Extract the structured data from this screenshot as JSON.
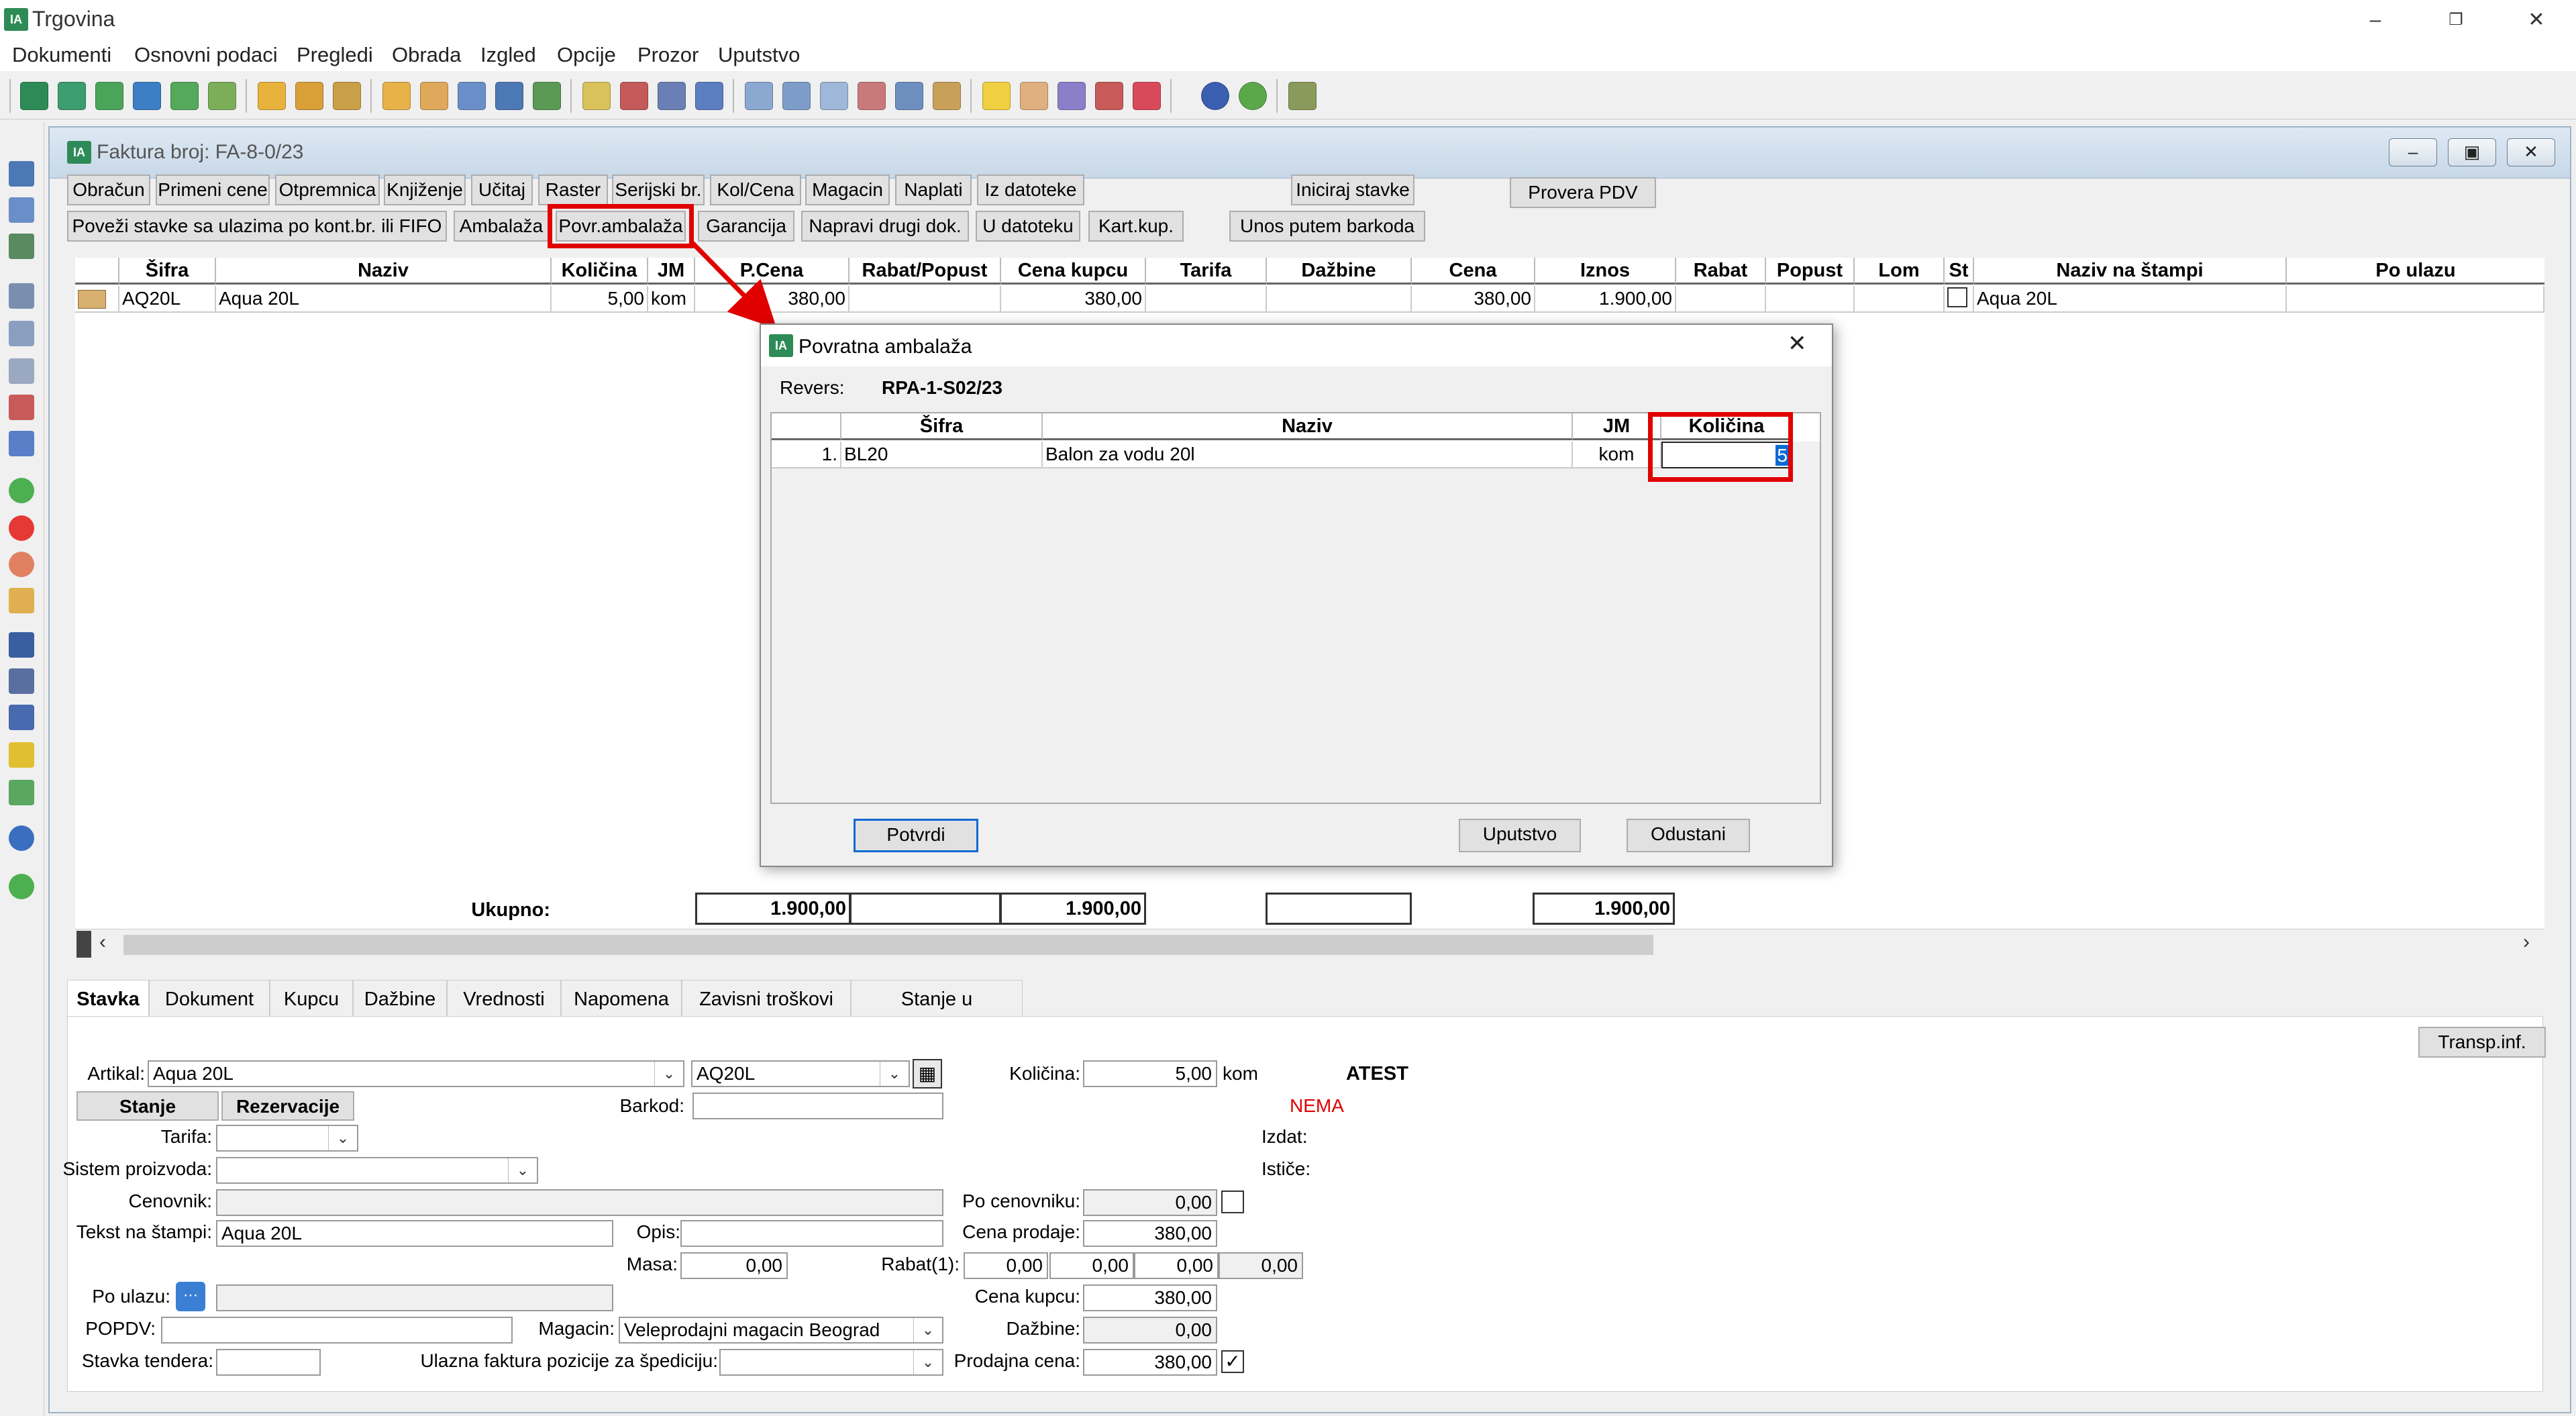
{
  "app": {
    "title": "Trgovina",
    "logo": "IA"
  },
  "menu": [
    "Dokumenti",
    "Osnovni podaci",
    "Pregledi",
    "Obrada",
    "Izgled",
    "Opcije",
    "Prozor",
    "Uputstvo"
  ],
  "window": {
    "title": "Faktura broj: FA-8-0/23"
  },
  "buttons_row1": [
    "Obračun",
    "Primeni cene",
    "Otpremnica",
    "Knjiženje",
    "Učitaj",
    "Raster",
    "Serijski br.",
    "Kol/Cena",
    "Magacin",
    "Naplati",
    "Iz datoteke",
    "Iniciraj stavke",
    "Provera PDV"
  ],
  "buttons_row2": [
    "Poveži stavke sa ulazima po kont.br. ili FIFO",
    "Ambalaža",
    "Povr.ambalaža",
    "Garancija",
    "Napravi drugi dok.",
    "U datoteku",
    "Kart.kup.",
    "Unos putem barkoda"
  ],
  "grid": {
    "headers": [
      "Šifra",
      "Naziv",
      "Količina",
      "JM",
      "P.Cena",
      "Rabat/Popust",
      "Cena kupcu",
      "Tarifa",
      "Dažbine",
      "Cena",
      "Iznos",
      "Rabat",
      "Popust",
      "Lom",
      "St",
      "Naziv na štampi",
      "Po ulazu"
    ],
    "row": {
      "sifra": "AQ20L",
      "naziv": "Aqua 20L",
      "kolicina": "5,00",
      "jm": "kom",
      "pcena": "380,00",
      "cena_kupcu": "380,00",
      "cena": "380,00",
      "iznos": "1.900,00",
      "naziv_stampi": "Aqua 20L"
    }
  },
  "totals": {
    "label": "Ukupno:",
    "pcena": "1.900,00",
    "cena_kupcu": "1.900,00",
    "iznos": "1.900,00"
  },
  "dialog": {
    "title": "Povratna ambalaža",
    "revers_label": "Revers:",
    "revers_value": "RPA-1-S02/23",
    "headers": [
      "Šifra",
      "Naziv",
      "JM",
      "Količina"
    ],
    "row": {
      "num": "1.",
      "sifra": "BL20",
      "naziv": "Balon za vodu 20l",
      "jm": "kom",
      "kolicina": "5"
    },
    "buttons": {
      "confirm": "Potvrdi",
      "help": "Uputstvo",
      "cancel": "Odustani"
    }
  },
  "tabs": [
    "Stavka",
    "Dokument",
    "Kupcu",
    "Dažbine",
    "Vrednosti",
    "Napomena",
    "Zavisni troškovi",
    "Stanje u magacinima"
  ],
  "form": {
    "transp_btn": "Transp.inf.",
    "artikal_label": "Artikal:",
    "artikal_value": "Aqua 20L",
    "artikal_code": "AQ20L",
    "stanje_btn": "Stanje",
    "rezervacije_btn": "Rezervacije",
    "kolicina_label": "Količina:",
    "kolicina_value": "5,00",
    "kolicina_unit": "kom",
    "atest": "ATEST",
    "nema": "NEMA",
    "barkod_label": "Barkod:",
    "izdat_label": "Izdat:",
    "istice_label": "Ističe:",
    "tarifa_label": "Tarifa:",
    "sistem_label": "Sistem proizvoda:",
    "cenovnik_label": "Cenovnik:",
    "po_cenovniku_label": "Po cenovniku:",
    "po_cenovniku_value": "0,00",
    "tekst_label": "Tekst na štampi:",
    "tekst_value": "Aqua 20L",
    "opis_label": "Opis:",
    "cena_prodaje_label": "Cena prodaje:",
    "cena_prodaje_value": "380,00",
    "masa_label": "Masa:",
    "masa_value": "0,00",
    "rabat_label": "Rabat(1):",
    "rabat_values": [
      "0,00",
      "0,00",
      "0,00",
      "0,00"
    ],
    "po_ulazu_label": "Po ulazu:",
    "cena_kupcu_label": "Cena kupcu:",
    "cena_kupcu_value": "380,00",
    "popdv_label": "POPDV:",
    "magacin_label": "Magacin:",
    "magacin_value": "Veleprodajni magacin Beograd",
    "dazbine_label": "Dažbine:",
    "dazbine_value": "0,00",
    "stavka_tendera_label": "Stavka tendera:",
    "ulazna_label": "Ulazna faktura pozicije za špediciju:",
    "prodajna_label": "Prodajna cena:",
    "prodajna_value": "380,00"
  },
  "colors": {
    "highlight": "#e00000",
    "mdi_title": "#c8d8e8",
    "nema": "#e00000"
  }
}
